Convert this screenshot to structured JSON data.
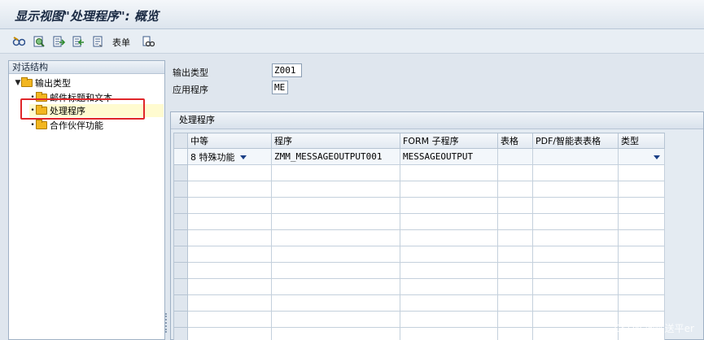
{
  "window": {
    "title": "显示视图\"处理程序\": 概览"
  },
  "toolbar": {
    "buttons": [
      {
        "icon": "glasses-edit-icon"
      },
      {
        "icon": "find-icon"
      },
      {
        "icon": "export-icon"
      },
      {
        "icon": "import-icon"
      },
      {
        "icon": "document-icon"
      }
    ],
    "table_label": "表单",
    "extra_icon": "settings-glasses-icon"
  },
  "tree": {
    "header": "对话结构",
    "root": "输出类型",
    "children": [
      {
        "label": "邮件标题和文本",
        "selected": false
      },
      {
        "label": "处理程序",
        "selected": true
      },
      {
        "label": "合作伙伴功能",
        "selected": false
      }
    ]
  },
  "header_fields": {
    "output_type_label": "输出类型",
    "output_type_value": "Z001",
    "application_label": "应用程序",
    "application_value": "ME"
  },
  "table": {
    "title": "处理程序",
    "columns": [
      "中等",
      "程序",
      "FORM 子程序",
      "表格",
      "PDF/智能表表格",
      "类型"
    ],
    "rows": [
      {
        "medium": "8 特殊功能",
        "program": "ZMM_MESSAGEOUTPUT001",
        "form_routine": "MESSAGEOUTPUT",
        "form": "",
        "pdf_form": "",
        "type": ""
      }
    ],
    "empty_rows": 11
  },
  "watermark": "CSDN @陈送平er",
  "colors": {
    "highlight_border": "#e0262a",
    "folder": "#f2b620",
    "selected_bg": "#fffbd0"
  }
}
